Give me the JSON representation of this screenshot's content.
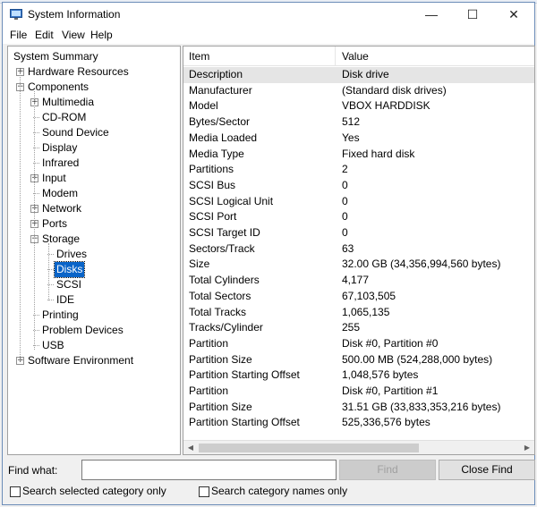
{
  "window": {
    "title": "System Information",
    "controls": {
      "minimize": "—",
      "maximize": "☐",
      "close": "✕"
    }
  },
  "menu": [
    "File",
    "Edit",
    "View",
    "Help"
  ],
  "tree": [
    {
      "label": "System Summary",
      "level": 0,
      "expander": "none"
    },
    {
      "label": "Hardware Resources",
      "level": 1,
      "expander": "plus"
    },
    {
      "label": "Components",
      "level": 1,
      "expander": "minus"
    },
    {
      "label": "Multimedia",
      "level": 2,
      "expander": "plus"
    },
    {
      "label": "CD-ROM",
      "level": 2,
      "expander": "none"
    },
    {
      "label": "Sound Device",
      "level": 2,
      "expander": "none"
    },
    {
      "label": "Display",
      "level": 2,
      "expander": "none"
    },
    {
      "label": "Infrared",
      "level": 2,
      "expander": "none"
    },
    {
      "label": "Input",
      "level": 2,
      "expander": "plus"
    },
    {
      "label": "Modem",
      "level": 2,
      "expander": "none"
    },
    {
      "label": "Network",
      "level": 2,
      "expander": "plus"
    },
    {
      "label": "Ports",
      "level": 2,
      "expander": "plus"
    },
    {
      "label": "Storage",
      "level": 2,
      "expander": "minus"
    },
    {
      "label": "Drives",
      "level": 3,
      "expander": "none"
    },
    {
      "label": "Disks",
      "level": 3,
      "expander": "none",
      "selected": true
    },
    {
      "label": "SCSI",
      "level": 3,
      "expander": "none"
    },
    {
      "label": "IDE",
      "level": 3,
      "expander": "none"
    },
    {
      "label": "Printing",
      "level": 2,
      "expander": "none"
    },
    {
      "label": "Problem Devices",
      "level": 2,
      "expander": "none"
    },
    {
      "label": "USB",
      "level": 2,
      "expander": "none"
    },
    {
      "label": "Software Environment",
      "level": 1,
      "expander": "plus"
    }
  ],
  "list": {
    "headers": {
      "item": "Item",
      "value": "Value"
    },
    "rows": [
      [
        "Description",
        "Disk drive"
      ],
      [
        "Manufacturer",
        "(Standard disk drives)"
      ],
      [
        "Model",
        "VBOX HARDDISK"
      ],
      [
        "Bytes/Sector",
        "512"
      ],
      [
        "Media Loaded",
        "Yes"
      ],
      [
        "Media Type",
        "Fixed hard disk"
      ],
      [
        "Partitions",
        "2"
      ],
      [
        "SCSI Bus",
        "0"
      ],
      [
        "SCSI Logical Unit",
        "0"
      ],
      [
        "SCSI Port",
        "0"
      ],
      [
        "SCSI Target ID",
        "0"
      ],
      [
        "Sectors/Track",
        "63"
      ],
      [
        "Size",
        "32.00 GB (34,356,994,560 bytes)"
      ],
      [
        "Total Cylinders",
        "4,177"
      ],
      [
        "Total Sectors",
        "67,103,505"
      ],
      [
        "Total Tracks",
        "1,065,135"
      ],
      [
        "Tracks/Cylinder",
        "255"
      ],
      [
        "Partition",
        "Disk #0, Partition #0"
      ],
      [
        "Partition Size",
        "500.00 MB (524,288,000 bytes)"
      ],
      [
        "Partition Starting Offset",
        "1,048,576 bytes"
      ],
      [
        "Partition",
        "Disk #0, Partition #1"
      ],
      [
        "Partition Size",
        "31.51 GB (33,833,353,216 bytes)"
      ],
      [
        "Partition Starting Offset",
        "525,336,576 bytes"
      ]
    ]
  },
  "find": {
    "label": "Find what:",
    "value": "",
    "find_button": "Find",
    "close_button": "Close Find",
    "search_selected": "Search selected category only",
    "search_names": "Search category names only"
  },
  "colors": {
    "selection": "#0a64c8",
    "accent": "#6b8cb8"
  }
}
